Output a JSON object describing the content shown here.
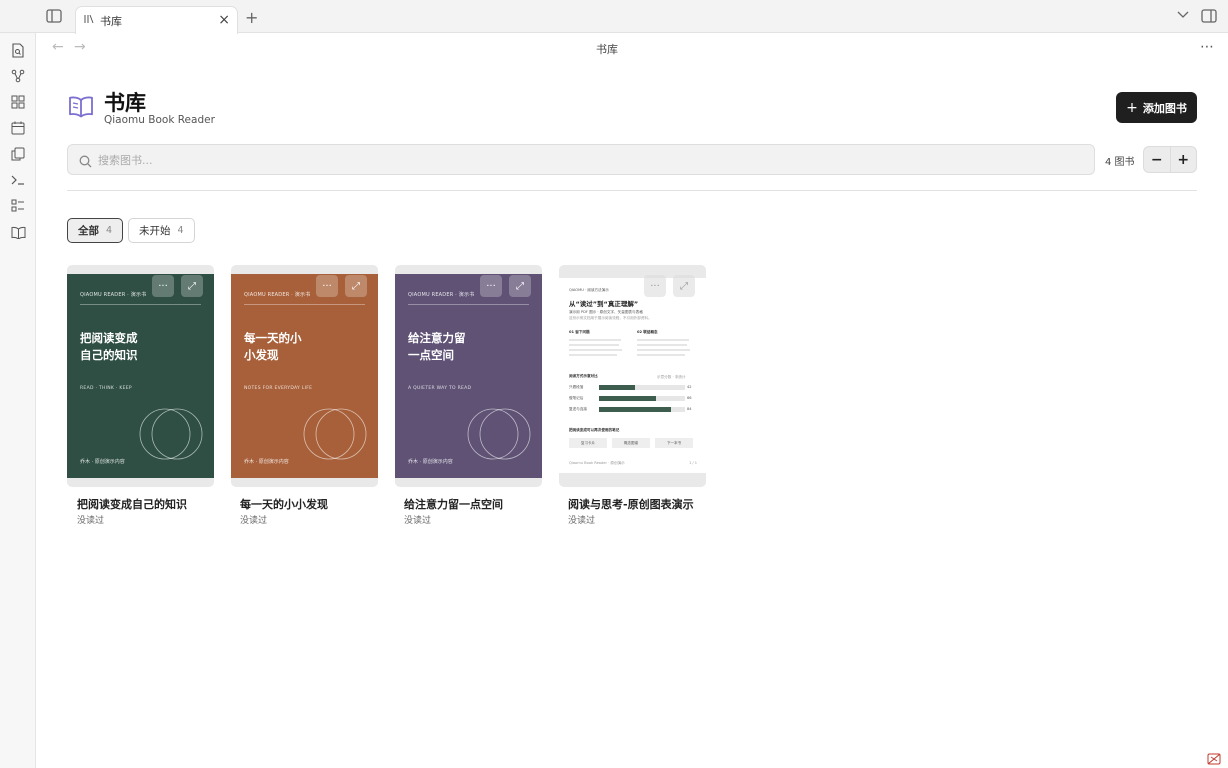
{
  "tabbar": {
    "tab_label": "书库",
    "tab_icon": "library-icon",
    "new_tab_label": "+"
  },
  "view": {
    "title": "书库",
    "more_label": "⋯"
  },
  "library": {
    "title": "书库",
    "subtitle": "Qiaomu Book Reader",
    "add_button": "添加图书",
    "search_placeholder": "搜索图书...",
    "book_count": "4 图书",
    "zoom_out": "−",
    "zoom_in": "+",
    "accent_color": "#7b6fd0"
  },
  "filters": [
    {
      "label": "全部",
      "count": "4",
      "active": true
    },
    {
      "label": "未开始",
      "count": "4",
      "active": false
    }
  ],
  "books": [
    {
      "name": "把阅读变成自己的知识",
      "status": "没读过",
      "cover_color": "#2f4f45",
      "cover_brand": "QIAOMU READER · 演示书",
      "cover_title": "把阅读变成\n自己的知识",
      "cover_tag": "READ · THINK · KEEP",
      "cover_foot": "乔木 · 原创演示内容"
    },
    {
      "name": "每一天的小小发现",
      "status": "没读过",
      "cover_color": "#a8603a",
      "cover_brand": "QIAOMU READER · 演示书",
      "cover_title": "每一天的小\n小发现",
      "cover_tag": "NOTES FOR EVERYDAY LIFE",
      "cover_foot": "乔木 · 原创演示内容"
    },
    {
      "name": "给注意力留一点空间",
      "status": "没读过",
      "cover_color": "#5f5275",
      "cover_brand": "QIAOMU READER · 演示书",
      "cover_title": "给注意力留\n一点空间",
      "cover_tag": "A QUIETER WAY TO READ",
      "cover_foot": "乔木 · 原创演示内容"
    },
    {
      "name": "阅读与思考-原创图表演示",
      "status": "没读过",
      "doc": {
        "brand": "QIAOMU  ·  阅读方法演示",
        "headline": "从“读过”到“真正理解”",
        "sub1": "演示用 PDF 图示 · 原创文字、矢量图表与表格",
        "sub2": "这份示例文档用于展示阅读流程，不引用外部资料。",
        "col1_title": "01  留下问题",
        "col2_title": "02  联结概念",
        "chart_title": "阅读方式示意对比",
        "chart_legend": "示意分数 · 非统计",
        "rows": [
          {
            "label": "只看段落",
            "value": "42"
          },
          {
            "label": "做笔记后",
            "value": "66"
          },
          {
            "label": "复述与连接",
            "value": "84"
          }
        ],
        "section2": "把阅读变成可以再次使用的笔记",
        "pills": [
          "复习卡片",
          "概念图谱",
          "下一本书"
        ],
        "foot_left": "Qiaomu Book Reader · 原创演示",
        "foot_right": "1 / 1"
      }
    }
  ]
}
